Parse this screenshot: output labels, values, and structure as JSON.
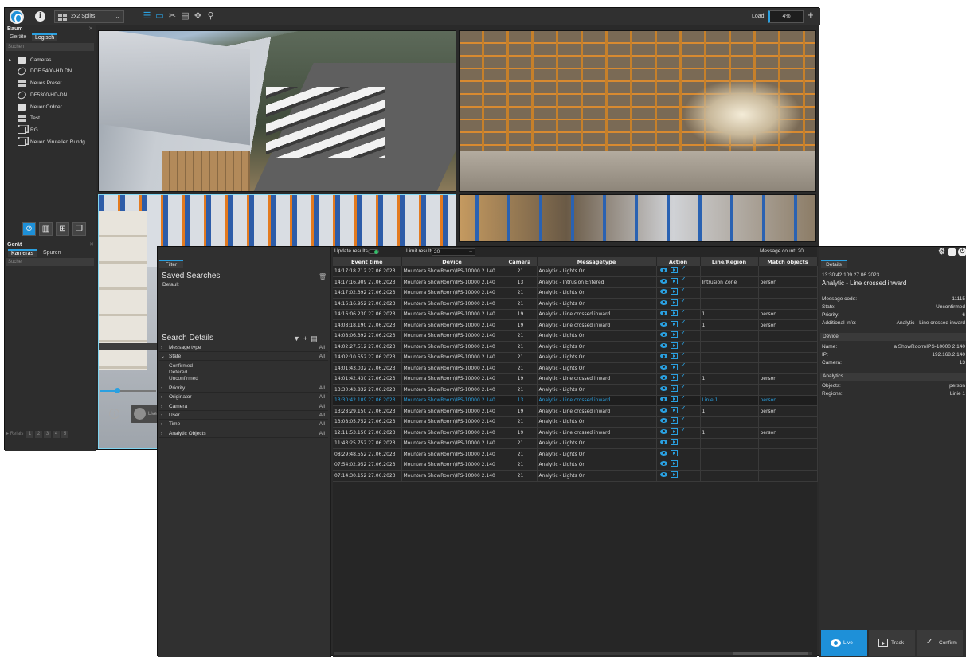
{
  "toolbar": {
    "split_label": "2x2 Splits",
    "load_label": "Load",
    "load_value": "4%"
  },
  "left_panel": {
    "title": "Baum",
    "tabs": [
      "Geräte",
      "Logisch"
    ],
    "search_placeholder": "Suchen",
    "tree": [
      {
        "label": "Cameras",
        "icon": "folder-icon"
      },
      {
        "label": "DDF 5400-HD DN",
        "icon": "camera-icon"
      },
      {
        "label": "Neues Preset",
        "icon": "grid-icon"
      },
      {
        "label": "DF5300-HD-DN",
        "icon": "camera-icon"
      },
      {
        "label": "Neuer Ordner",
        "icon": "folder-icon"
      },
      {
        "label": "Test",
        "icon": "grid-icon"
      },
      {
        "label": "RG",
        "icon": "stack-icon"
      },
      {
        "label": "Neuen Virutellen Rundg...",
        "icon": "stack-icon"
      }
    ],
    "device_title": "Gerät",
    "device_tabs": [
      "Kameras",
      "Spuren"
    ],
    "device_search_placeholder": "Suche",
    "relais_label": "Relais",
    "relais": [
      "1",
      "2",
      "3",
      "4",
      "5"
    ],
    "live_label": "Live"
  },
  "filter": {
    "tab": "Filter",
    "saved_title": "Saved Searches",
    "saved_default": "Default",
    "details_title": "Search Details",
    "rows": [
      {
        "label": "Message type",
        "value": "All",
        "expanded": false
      },
      {
        "label": "State",
        "value": "All",
        "expanded": true
      },
      {
        "label": "Priority",
        "value": "All",
        "expanded": false
      },
      {
        "label": "Originator",
        "value": "All",
        "expanded": false
      },
      {
        "label": "Camera",
        "value": "All",
        "expanded": false
      },
      {
        "label": "User",
        "value": "All",
        "expanded": false
      },
      {
        "label": "Time",
        "value": "All",
        "expanded": false
      },
      {
        "label": "Analytic Objects",
        "value": "All",
        "expanded": false
      }
    ],
    "state_options": [
      "Confirmed",
      "Defered",
      "Unconfirmed"
    ]
  },
  "results": {
    "update_label": "Update results",
    "limit_label": "Limit results",
    "limit_value": "20",
    "message_count": "Message count: 20",
    "columns": [
      "Event time",
      "Device",
      "Camera",
      "Messagetype",
      "Action",
      "Line/Region",
      "Match objects"
    ],
    "rows": [
      {
        "time": "14:17:18.712 27.06.2023",
        "device": "Mountera ShowRoom\\IPS-10000 2.140",
        "camera": "21",
        "type": "Analytic - Lights On",
        "region": "",
        "match": "",
        "confirm": true
      },
      {
        "time": "14:17:16.909 27.06.2023",
        "device": "Mountera ShowRoom\\IPS-10000 2.140",
        "camera": "13",
        "type": "Analytic - Intrusion Entered",
        "region": "Intrusion Zone",
        "match": "person",
        "confirm": true
      },
      {
        "time": "14:17:02.392 27.06.2023",
        "device": "Mountera ShowRoom\\IPS-10000 2.140",
        "camera": "21",
        "type": "Analytic - Lights On",
        "region": "",
        "match": "",
        "confirm": true
      },
      {
        "time": "14:16:16.952 27.06.2023",
        "device": "Mountera ShowRoom\\IPS-10000 2.140",
        "camera": "21",
        "type": "Analytic - Lights On",
        "region": "",
        "match": "",
        "confirm": true
      },
      {
        "time": "14:16:06.230 27.06.2023",
        "device": "Mountera ShowRoom\\IPS-10000 2.140",
        "camera": "19",
        "type": "Analytic - Line crossed inward",
        "region": "1",
        "match": "person",
        "confirm": true
      },
      {
        "time": "14:08:18.190 27.06.2023",
        "device": "Mountera ShowRoom\\IPS-10000 2.140",
        "camera": "19",
        "type": "Analytic - Line crossed inward",
        "region": "1",
        "match": "person",
        "confirm": true
      },
      {
        "time": "14:08:06.392 27.06.2023",
        "device": "Mountera ShowRoom\\IPS-10000 2.140",
        "camera": "21",
        "type": "Analytic - Lights On",
        "region": "",
        "match": "",
        "confirm": true
      },
      {
        "time": "14:02:27.512 27.06.2023",
        "device": "Mountera ShowRoom\\IPS-10000 2.140",
        "camera": "21",
        "type": "Analytic - Lights On",
        "region": "",
        "match": "",
        "confirm": true
      },
      {
        "time": "14:02:10.552 27.06.2023",
        "device": "Mountera ShowRoom\\IPS-10000 2.140",
        "camera": "21",
        "type": "Analytic - Lights On",
        "region": "",
        "match": "",
        "confirm": true
      },
      {
        "time": "14:01:43.032 27.06.2023",
        "device": "Mountera ShowRoom\\IPS-10000 2.140",
        "camera": "21",
        "type": "Analytic - Lights On",
        "region": "",
        "match": "",
        "confirm": true
      },
      {
        "time": "14:01:42.430 27.06.2023",
        "device": "Mountera ShowRoom\\IPS-10000 2.140",
        "camera": "19",
        "type": "Analytic - Line crossed inward",
        "region": "1",
        "match": "person",
        "confirm": true
      },
      {
        "time": "13:30:43.832 27.06.2023",
        "device": "Mountera ShowRoom\\IPS-10000 2.140",
        "camera": "21",
        "type": "Analytic - Lights On",
        "region": "",
        "match": "",
        "confirm": true
      },
      {
        "time": "13:30:42.109 27.06.2023",
        "device": "Mountera ShowRoom\\IPS-10000 2.140",
        "camera": "13",
        "type": "Analytic - Line crossed inward",
        "region": "Linie 1",
        "match": "person",
        "confirm": true,
        "selected": true
      },
      {
        "time": "13:28:29.150 27.06.2023",
        "device": "Mountera ShowRoom\\IPS-10000 2.140",
        "camera": "19",
        "type": "Analytic - Line crossed inward",
        "region": "1",
        "match": "person",
        "confirm": true
      },
      {
        "time": "13:08:05.752 27.06.2023",
        "device": "Mountera ShowRoom\\IPS-10000 2.140",
        "camera": "21",
        "type": "Analytic - Lights On",
        "region": "",
        "match": "",
        "confirm": true
      },
      {
        "time": "12:11:53.150 27.06.2023",
        "device": "Mountera ShowRoom\\IPS-10000 2.140",
        "camera": "19",
        "type": "Analytic - Line crossed inward",
        "region": "1",
        "match": "person",
        "confirm": true
      },
      {
        "time": "11:43:25.752 27.06.2023",
        "device": "Mountera ShowRoom\\IPS-10000 2.140",
        "camera": "21",
        "type": "Analytic - Lights On",
        "region": "",
        "match": "",
        "confirm": false
      },
      {
        "time": "08:29:48.552 27.06.2023",
        "device": "Mountera ShowRoom\\IPS-10000 2.140",
        "camera": "21",
        "type": "Analytic - Lights On",
        "region": "",
        "match": "",
        "confirm": false
      },
      {
        "time": "07:54:02.952 27.06.2023",
        "device": "Mountera ShowRoom\\IPS-10000 2.140",
        "camera": "21",
        "type": "Analytic - Lights On",
        "region": "",
        "match": "",
        "confirm": false
      },
      {
        "time": "07:14:30.152 27.06.2023",
        "device": "Mountera ShowRoom\\IPS-10000 2.140",
        "camera": "21",
        "type": "Analytic - Lights On",
        "region": "",
        "match": "",
        "confirm": false
      }
    ]
  },
  "details": {
    "tab": "Details",
    "time": "13:30:42.109 27.06.2023",
    "title": "Analytic - Line crossed inward",
    "fields": [
      {
        "label": "Message code:",
        "value": "11115"
      },
      {
        "label": "State:",
        "value": "Unconfirmed"
      },
      {
        "label": "Priority:",
        "value": "6"
      },
      {
        "label": "Additional Info:",
        "value": "Analytic - Line crossed inward"
      }
    ],
    "device_section": "Device",
    "device_fields": [
      {
        "label": "Name:",
        "value": "a ShowRoom\\IPS-10000 2.140"
      },
      {
        "label": "IP:",
        "value": "192.168.2.140"
      },
      {
        "label": "Camera:",
        "value": "13"
      }
    ],
    "analytics_section": "Analytics",
    "analytics_fields": [
      {
        "label": "Objects:",
        "value": "person"
      },
      {
        "label": "Regions:",
        "value": "Linie 1"
      }
    ],
    "buttons": {
      "live": "Live",
      "track": "Track",
      "confirm": "Confirm"
    }
  },
  "colors": {
    "accent": "#2aa0e0",
    "selected_row_text": "#2aa0e0",
    "background": "#2b2b2b"
  }
}
